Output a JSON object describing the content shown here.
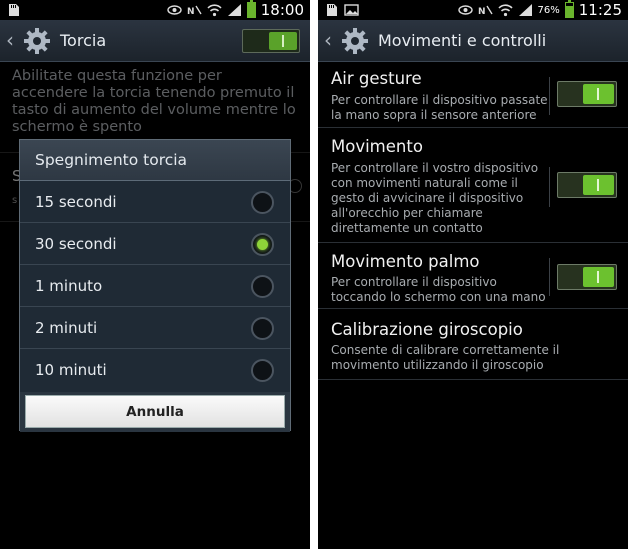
{
  "left": {
    "status": {
      "time": "18:00"
    },
    "title": "Torcia",
    "master_switch": true,
    "description": "Abilitate questa funzione per accendere la torcia tenendo premuto il tasto di aumento del volume mentre lo schermo è spento",
    "dialog": {
      "title": "Spegnimento torcia",
      "options": [
        {
          "label": "15 secondi",
          "selected": false
        },
        {
          "label": "30 secondi",
          "selected": true
        },
        {
          "label": "1 minuto",
          "selected": false
        },
        {
          "label": "2 minuti",
          "selected": false
        },
        {
          "label": "10 minuti",
          "selected": false
        }
      ],
      "cancel_label": "Annulla"
    }
  },
  "right": {
    "status": {
      "time": "11:25",
      "battery": "76%"
    },
    "title": "Movimenti e controlli",
    "items": [
      {
        "title": "Air gesture",
        "subtitle": "Per controllare il dispositivo passate la mano sopra il sensore anteriore",
        "toggle": true
      },
      {
        "title": "Movimento",
        "subtitle": "Per controllare il vostro dispositivo con movimenti naturali come il gesto di avvicinare il dispositivo all'orecchio per chiamare direttamente un contatto",
        "toggle": true
      },
      {
        "title": "Movimento palmo",
        "subtitle": "Per controllare il dispositivo toccando lo schermo con una mano",
        "toggle": true
      },
      {
        "title": "Calibrazione giroscopio",
        "subtitle": "Consente di calibrare correttamente il movimento utilizzando il giroscopio"
      }
    ]
  },
  "colors": {
    "accent_green": "#6cc12f",
    "actionbar": "#2b3440",
    "dialog": "#1f2a35"
  }
}
